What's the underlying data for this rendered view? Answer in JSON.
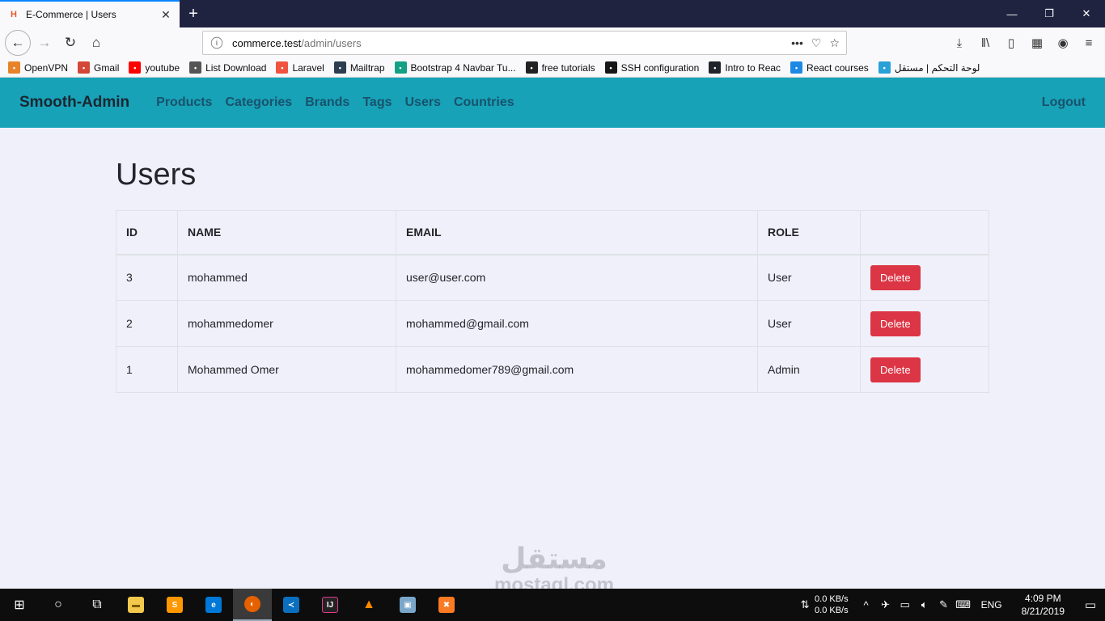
{
  "browser": {
    "tab_title": "E-Commerce | Users",
    "url_host": "commerce.test",
    "url_path": "/admin/users",
    "bookmarks": [
      {
        "label": "OpenVPN",
        "icon": "openvpn-icon",
        "color": "#e8832a"
      },
      {
        "label": "Gmail",
        "icon": "gmail-icon",
        "color": "#d44638"
      },
      {
        "label": "youtube",
        "icon": "youtube-icon",
        "color": "#ff0000"
      },
      {
        "label": "List Download",
        "icon": "globe-icon",
        "color": "#555555"
      },
      {
        "label": "Laravel",
        "icon": "laravel-icon",
        "color": "#f05340"
      },
      {
        "label": "Mailtrap",
        "icon": "mailtrap-icon",
        "color": "#2c3e50"
      },
      {
        "label": "Bootstrap 4 Navbar Tu...",
        "icon": "bootstrap-icon",
        "color": "#14a085"
      },
      {
        "label": "free tutorials",
        "icon": "tutorial-icon",
        "color": "#222222"
      },
      {
        "label": "SSH configuration",
        "icon": "github-icon",
        "color": "#181717"
      },
      {
        "label": "Intro to Reac",
        "icon": "react-icon",
        "color": "#20232a"
      },
      {
        "label": "React courses",
        "icon": "react-courses-icon",
        "color": "#1e88e5"
      },
      {
        "label": "لوحة التحكم | مستقل",
        "icon": "mostaql-icon",
        "color": "#2aa0d8"
      }
    ]
  },
  "app": {
    "brand": "Smooth-Admin",
    "nav": [
      "Products",
      "Categories",
      "Brands",
      "Tags",
      "Users",
      "Countries"
    ],
    "logout": "Logout",
    "colors": {
      "navbar": "#17a2b8",
      "link": "#19526b",
      "danger": "#dc3545"
    }
  },
  "page": {
    "title": "Users",
    "table": {
      "headers": [
        "ID",
        "NAME",
        "EMAIL",
        "ROLE",
        ""
      ],
      "rows": [
        {
          "id": "3",
          "name": "mohammed",
          "email": "user@user.com",
          "role": "User",
          "action": "Delete"
        },
        {
          "id": "2",
          "name": "mohammedomer",
          "email": "mohammed@gmail.com",
          "role": "User",
          "action": "Delete"
        },
        {
          "id": "1",
          "name": "Mohammed Omer",
          "email": "mohammedomer789@gmail.com",
          "role": "Admin",
          "action": "Delete"
        }
      ]
    }
  },
  "watermark": {
    "arabic": "مستقل",
    "latin": "mostaql.com"
  },
  "taskbar": {
    "upload_speed": "0.0 KB/s",
    "download_speed": "0.0 KB/s",
    "language": "ENG",
    "time": "4:09 PM",
    "date": "8/21/2019"
  }
}
